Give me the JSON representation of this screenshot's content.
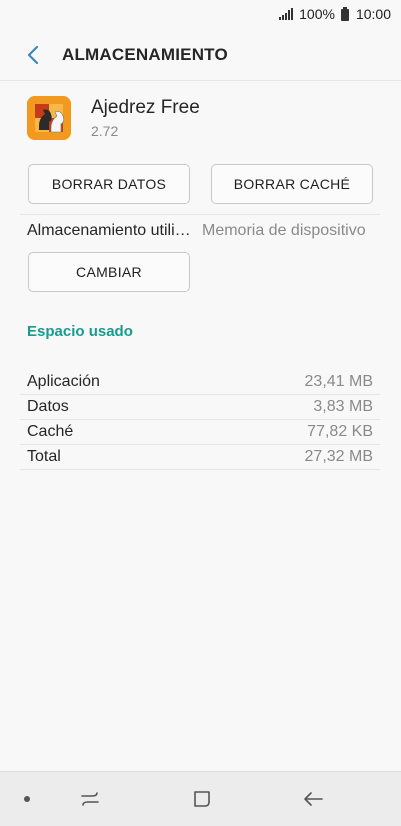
{
  "status_bar": {
    "battery": "100%",
    "time": "10:00"
  },
  "header": {
    "title": "ALMACENAMIENTO"
  },
  "app": {
    "name": "Ajedrez Free",
    "version": "2.72"
  },
  "buttons": {
    "clear_data": "BORRAR DATOS",
    "clear_cache": "BORRAR CACHÉ",
    "change": "CAMBIAR"
  },
  "storage_used": {
    "label": "Almacenamiento utilizado",
    "value": "Memoria de dispositivo"
  },
  "section": {
    "title": "Espacio usado"
  },
  "usage": [
    {
      "label": "Aplicación",
      "value": "23,41 MB"
    },
    {
      "label": "Datos",
      "value": "3,83 MB"
    },
    {
      "label": "Caché",
      "value": "77,82 KB"
    },
    {
      "label": "Total",
      "value": "27,32 MB"
    }
  ],
  "colors": {
    "accent": "#179c8e",
    "icon_bg": "#f29a1d",
    "back_arrow": "#3f87b4"
  },
  "icons": {
    "signal": "signal-icon",
    "battery": "battery-icon",
    "back": "back-arrow-icon",
    "app": "chess-app-icon",
    "recents": "recents-icon",
    "home": "home-icon",
    "nav_back": "nav-back-icon"
  }
}
